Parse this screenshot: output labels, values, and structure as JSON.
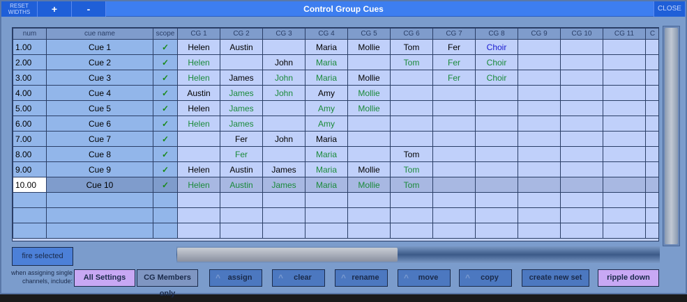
{
  "window": {
    "title": "Control Group Cues",
    "reset_widths": "RESET WIDTHS",
    "plus": "+",
    "minus": "-",
    "close": "CLOSE"
  },
  "table": {
    "headers": [
      "num",
      "cue name",
      "scope",
      "CG 1",
      "CG 2",
      "CG 3",
      "CG 4",
      "CG 5",
      "CG 6",
      "CG 7",
      "CG 8",
      "CG 9",
      "CG 10",
      "CG 11",
      "C"
    ],
    "scope_icon": "checkmark-icon",
    "scope_mark": "✓",
    "colors": {
      "black": "#000000",
      "green": "#1a8a3a",
      "blue": "#1a1ad0"
    },
    "selected_row": 9,
    "rows": [
      {
        "num": "1.00",
        "name": "Cue 1",
        "cells": [
          [
            "Helen",
            "k"
          ],
          [
            "Austin",
            "k"
          ],
          [
            "",
            ""
          ],
          [
            "Maria",
            "k"
          ],
          [
            "Mollie",
            "k"
          ],
          [
            "Tom",
            "k"
          ],
          [
            "Fer",
            "k"
          ],
          [
            "Choir",
            "b"
          ]
        ]
      },
      {
        "num": "2.00",
        "name": "Cue 2",
        "cells": [
          [
            "Helen",
            "g"
          ],
          [
            "",
            ""
          ],
          [
            "John",
            "k"
          ],
          [
            "Maria",
            "g"
          ],
          [
            "",
            ""
          ],
          [
            "Tom",
            "g"
          ],
          [
            "Fer",
            "g"
          ],
          [
            "Choir",
            "g"
          ]
        ]
      },
      {
        "num": "3.00",
        "name": "Cue 3",
        "cells": [
          [
            "Helen",
            "g"
          ],
          [
            "James",
            "k"
          ],
          [
            "John",
            "g"
          ],
          [
            "Maria",
            "g"
          ],
          [
            "Mollie",
            "k"
          ],
          [
            "",
            ""
          ],
          [
            "Fer",
            "g"
          ],
          [
            "Choir",
            "g"
          ]
        ]
      },
      {
        "num": "4.00",
        "name": "Cue 4",
        "cells": [
          [
            "Austin",
            "k"
          ],
          [
            "James",
            "g"
          ],
          [
            "John",
            "g"
          ],
          [
            "Amy",
            "k"
          ],
          [
            "Mollie",
            "g"
          ]
        ]
      },
      {
        "num": "5.00",
        "name": "Cue 5",
        "cells": [
          [
            "Helen",
            "k"
          ],
          [
            "James",
            "g"
          ],
          [
            "",
            ""
          ],
          [
            "Amy",
            "g"
          ],
          [
            "Mollie",
            "g"
          ]
        ]
      },
      {
        "num": "6.00",
        "name": "Cue 6",
        "cells": [
          [
            "Helen",
            "g"
          ],
          [
            "James",
            "g"
          ],
          [
            "",
            ""
          ],
          [
            "Amy",
            "g"
          ]
        ]
      },
      {
        "num": "7.00",
        "name": "Cue 7",
        "cells": [
          [
            "",
            ""
          ],
          [
            "Fer",
            "k"
          ],
          [
            "John",
            "k"
          ],
          [
            "Maria",
            "k"
          ]
        ]
      },
      {
        "num": "8.00",
        "name": "Cue 8",
        "cells": [
          [
            "",
            ""
          ],
          [
            "Fer",
            "g"
          ],
          [
            "",
            ""
          ],
          [
            "Maria",
            "g"
          ],
          [
            "",
            ""
          ],
          [
            "Tom",
            "k"
          ]
        ]
      },
      {
        "num": "9.00",
        "name": "Cue 9",
        "cells": [
          [
            "Helen",
            "k"
          ],
          [
            "Austin",
            "k"
          ],
          [
            "James",
            "k"
          ],
          [
            "Maria",
            "g"
          ],
          [
            "Mollie",
            "k"
          ],
          [
            "Tom",
            "g"
          ]
        ]
      },
      {
        "num": "10.00",
        "name": "Cue 10",
        "cells": [
          [
            "Helen",
            "g"
          ],
          [
            "Austin",
            "g"
          ],
          [
            "James",
            "g"
          ],
          [
            "Maria",
            "g"
          ],
          [
            "Mollie",
            "g"
          ],
          [
            "Tom",
            "g"
          ]
        ]
      }
    ],
    "empty_rows": 3
  },
  "controls": {
    "fire_selected": "fire selected",
    "hint": "when assigning single channels, include:",
    "all_settings": "All Settings",
    "cg_members_only": "CG Members only",
    "assign": "assign",
    "clear": "clear",
    "rename": "rename",
    "move": "move",
    "copy": "copy",
    "create_new_set": "create new set",
    "ripple_down": "ripple down",
    "caret": "^"
  }
}
